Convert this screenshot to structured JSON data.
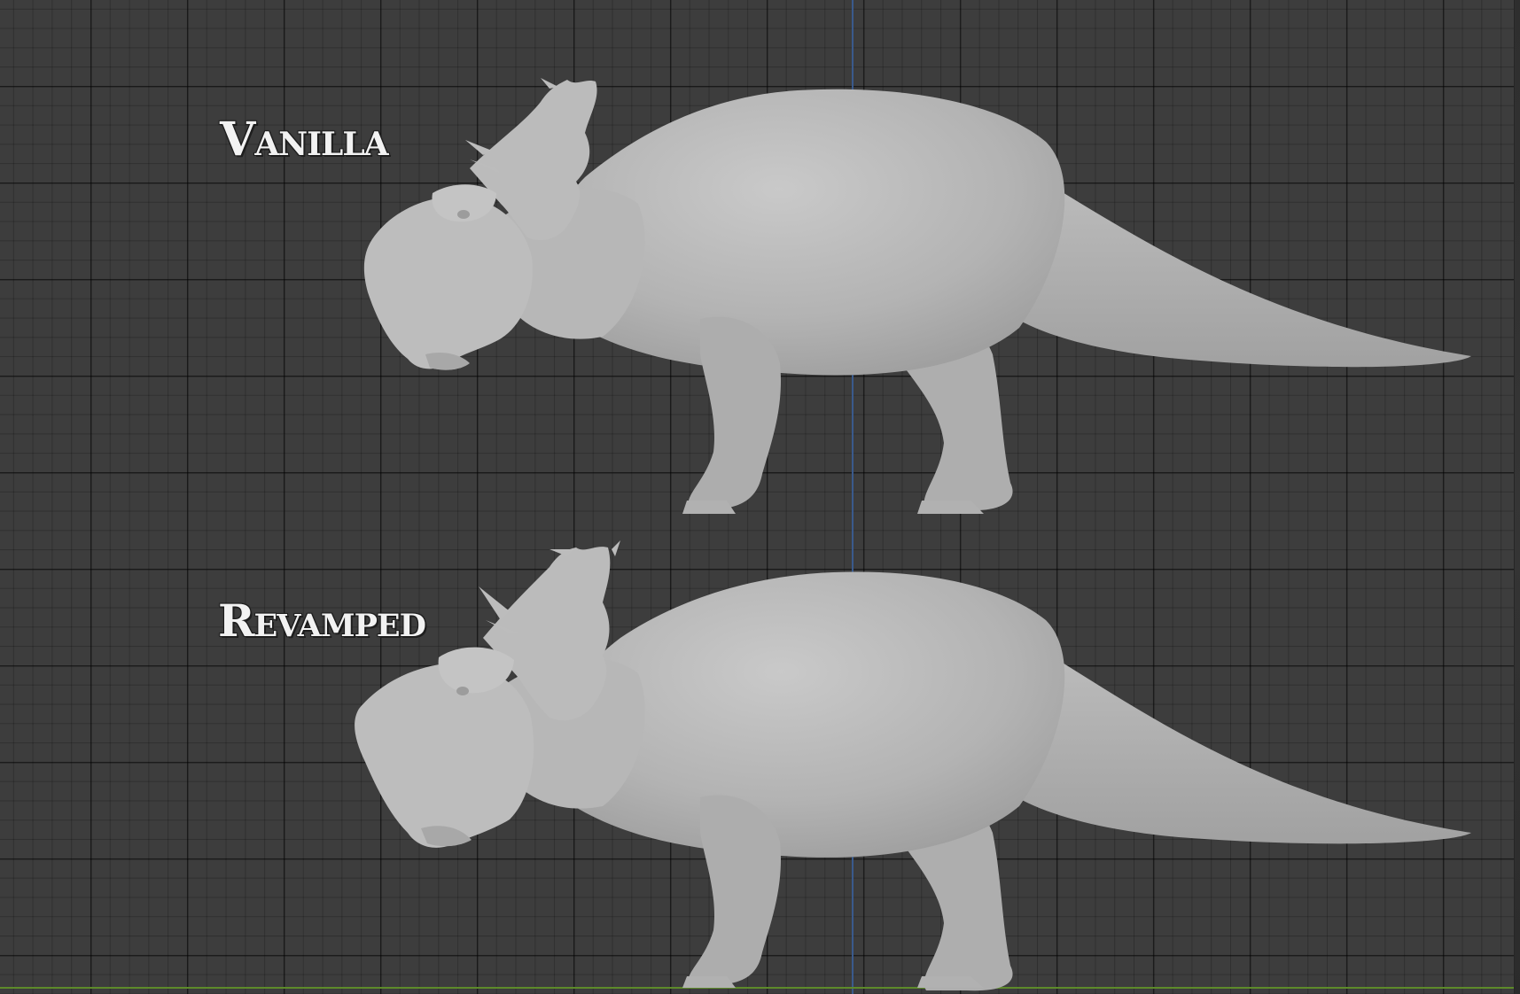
{
  "viewport": {
    "background_color": "#3d3d3d",
    "grid_line_color": "#2a2a2a",
    "z_axis_color": "#3a5a8c",
    "y_axis_color": "#5d8a2a",
    "model_color": "#b9b9b9"
  },
  "labels": {
    "vanilla": "Vanilla",
    "revamped": "Revamped"
  },
  "models": {
    "vanilla_icon": "ceratopsian-model-icon",
    "revamped_icon": "ceratopsian-model-icon"
  }
}
